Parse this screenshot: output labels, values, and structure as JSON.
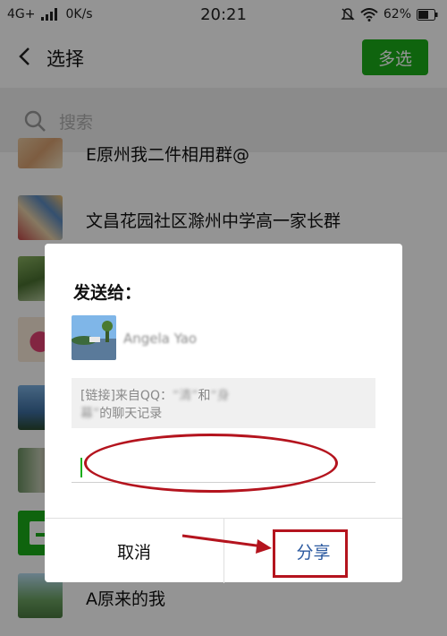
{
  "status_bar": {
    "network": "4G+",
    "speed": "0K/s",
    "time": "20:21",
    "battery": "62%"
  },
  "header": {
    "title": "选择",
    "multi_select_label": "多选"
  },
  "search": {
    "placeholder": "搜索"
  },
  "list": {
    "items": [
      {
        "name": "E原州我二件相用群@"
      },
      {
        "name": "文昌花园社区滁州中学高一家长群"
      },
      {
        "name": ""
      },
      {
        "name": ""
      },
      {
        "name": ""
      },
      {
        "name": ""
      },
      {
        "name": ""
      },
      {
        "name": "A原来的我"
      }
    ]
  },
  "dialog": {
    "send_to_label": "发送给：",
    "recipient_name": "Angela Yao",
    "message_prefix": "[链接]来自QQ：",
    "message_quote1": "“清”",
    "message_and": "和",
    "message_quote2": "“身        ",
    "message_line2_blur": "    幕”",
    "message_suffix": "的聊天记录",
    "cancel_label": "取消",
    "share_label": "分享"
  },
  "colors": {
    "accent_green": "#1aad19",
    "annotation_red": "#b4141e",
    "share_blue": "#2c5aa0"
  }
}
